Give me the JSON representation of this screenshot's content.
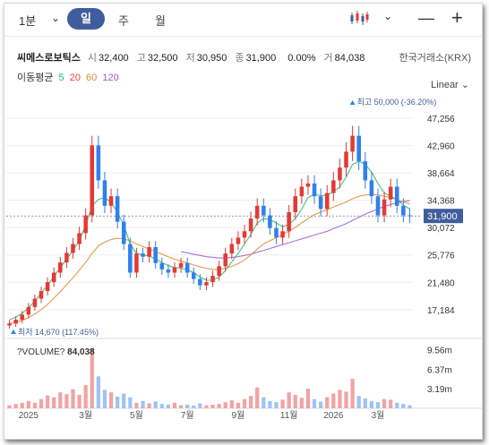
{
  "toolbar": {
    "interval": "1분",
    "tabs": [
      {
        "label": "일",
        "active": true
      },
      {
        "label": "주",
        "active": false
      },
      {
        "label": "월",
        "active": false
      }
    ],
    "chart_type_icon": "candlestick-icon",
    "zoom_out": "—",
    "zoom_in": "+"
  },
  "quote": {
    "name": "씨메스로보틱스",
    "open_label": "시",
    "open": "32,400",
    "high_label": "고",
    "high": "32,500",
    "low_label": "저",
    "low": "30,950",
    "close_label": "종",
    "close": "31,900",
    "change_pct": "0.00%",
    "volume_label": "거",
    "volume": "84,038",
    "exchange": "한국거래소(KRX)"
  },
  "moving_average": {
    "label": "이동평균",
    "periods": [
      {
        "label": "5",
        "color": "#2db36a"
      },
      {
        "label": "20",
        "color": "#e64545"
      },
      {
        "label": "60",
        "color": "#e08a2e"
      },
      {
        "label": "120",
        "color": "#9b59d0"
      }
    ]
  },
  "scale_label": "Linear",
  "colors": {
    "up": "#e53935",
    "down": "#2f80ed",
    "ma5": "#2db36a",
    "ma20": "#e64545",
    "ma60": "#e08a2e",
    "ma120": "#9b59d0",
    "accent": "#3f5d9c"
  },
  "chart_data": {
    "type": "candlestick",
    "y_axis_ticks": [
      "47,256",
      "42,960",
      "38,664",
      "34,368",
      "30,072",
      "25,776",
      "21,480",
      "17,184"
    ],
    "x_axis_ticks": [
      "2025",
      "3월",
      "5월",
      "7월",
      "9월",
      "11월",
      "2026",
      "3월"
    ],
    "current_price": "31,900",
    "max_label": "최고 50,000 (-36.20%)",
    "min_label": "최저 14,670 (117.45%)",
    "ylim": [
      13500,
      50500
    ],
    "close_series": [
      15000,
      15600,
      16400,
      17600,
      18900,
      20100,
      21500,
      23000,
      24600,
      26100,
      27500,
      29200,
      32000,
      43000,
      37500,
      33500,
      35000,
      31000,
      27500,
      23000,
      26000,
      25500,
      27000,
      24500,
      23500,
      23000,
      23800,
      24500,
      23000,
      22000,
      21000,
      21500,
      22500,
      24000,
      26000,
      27500,
      28500,
      29500,
      31500,
      33500,
      32000,
      30000,
      28500,
      29500,
      32500,
      35000,
      36500,
      37000,
      35000,
      33000,
      35500,
      37500,
      39500,
      42000,
      44500,
      40500,
      37500,
      35000,
      32000,
      34500,
      36500,
      33500,
      32000,
      31900
    ],
    "ma5": [
      15600,
      16000,
      16600,
      17500,
      18500,
      19800,
      21000,
      22400,
      23800,
      25100,
      26500,
      28000,
      30500,
      33500,
      34500,
      34800,
      34000,
      32500,
      30500,
      27500,
      26000,
      25800,
      25600,
      25100,
      24600,
      24100,
      23800,
      23700,
      23400,
      23000,
      22300,
      21800,
      21800,
      22300,
      23300,
      24700,
      26000,
      27500,
      29000,
      30800,
      31500,
      31300,
      30800,
      30200,
      30600,
      31500,
      33000,
      34800,
      35300,
      35100,
      35200,
      35700,
      36500,
      38000,
      40000,
      40500,
      40000,
      38800,
      37000,
      35500,
      35000,
      34500,
      33600,
      33000
    ],
    "ma60": [
      15000,
      15200,
      15500,
      15900,
      16500,
      17200,
      18000,
      19000,
      20000,
      21100,
      22200,
      23400,
      24600,
      26000,
      27200,
      27800,
      28200,
      28400,
      28300,
      28000,
      27500,
      27100,
      26700,
      26300,
      25900,
      25500,
      25100,
      24800,
      24500,
      24200,
      23900,
      23700,
      23500,
      23500,
      23700,
      24000,
      24400,
      25000,
      25800,
      26700,
      27500,
      28000,
      28500,
      29000,
      29500,
      30100,
      30800,
      31500,
      32100,
      32500,
      32900,
      33300,
      33700,
      34100,
      34600,
      35000,
      35200,
      35300,
      35200,
      35000,
      34800,
      34500,
      34100,
      33800
    ],
    "ma120": [
      null,
      null,
      null,
      null,
      null,
      null,
      null,
      null,
      null,
      null,
      null,
      null,
      null,
      null,
      null,
      null,
      null,
      null,
      null,
      null,
      null,
      null,
      null,
      null,
      null,
      null,
      null,
      26300,
      26100,
      25900,
      25700,
      25500,
      25400,
      25300,
      25300,
      25400,
      25500,
      25700,
      25900,
      26200,
      26500,
      26800,
      27100,
      27400,
      27700,
      28000,
      28300,
      28600,
      28900,
      29200,
      29500,
      29900,
      30300,
      30700,
      31200,
      31700,
      32200,
      32600,
      33000,
      33400,
      33700,
      34000,
      34200,
      34300
    ],
    "volume_axis_ticks": [
      "9.56m",
      "6.37m",
      "3.19m"
    ],
    "volume_label": "?VOLUME?",
    "volume_value": "84,038",
    "volume_max": 10500000,
    "volumes": [
      500000,
      700000,
      900000,
      1200000,
      900000,
      1500000,
      2100000,
      1800000,
      2600000,
      2300000,
      3100000,
      2200000,
      3800000,
      9800000,
      5200000,
      3000000,
      2600000,
      1900000,
      2400000,
      1800000,
      900000,
      1200000,
      800000,
      1100000,
      700000,
      600000,
      900000,
      500000,
      600000,
      450000,
      800000,
      500000,
      600000,
      700000,
      1000000,
      1300000,
      900000,
      1500000,
      2000000,
      3400000,
      1800000,
      1200000,
      1000000,
      1400000,
      2600000,
      2200000,
      1700000,
      3200000,
      1500000,
      1100000,
      1800000,
      2400000,
      3000000,
      2700000,
      4800000,
      2000000,
      1600000,
      1200000,
      1000000,
      1500000,
      1400000,
      900000,
      700000,
      500000
    ]
  }
}
